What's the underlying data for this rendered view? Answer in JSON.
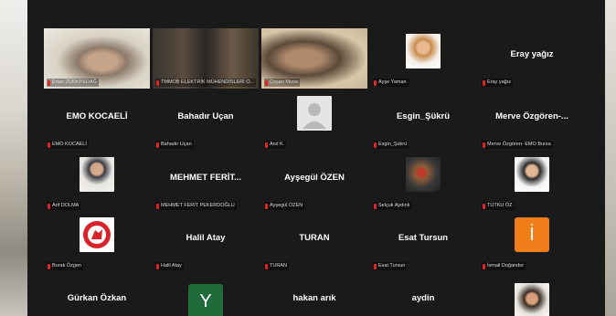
{
  "participants": [
    {
      "id": "p1",
      "display": "",
      "label": "Ertan ZÜRKPEDAĞ",
      "kind": "video"
    },
    {
      "id": "p2",
      "display": "",
      "label": "TMMOB ELEKTRİK MÜHENDİSLERİ O...",
      "kind": "video"
    },
    {
      "id": "p3",
      "display": "",
      "label": "Coşan Musa",
      "kind": "video"
    },
    {
      "id": "p4",
      "display": "",
      "label": "Ayşe Yaman",
      "kind": "avatar",
      "icon": "profile-photo-icon"
    },
    {
      "id": "p5",
      "display": "Eray yağız",
      "label": "Eray yağız",
      "kind": "name"
    },
    {
      "id": "p6",
      "display": "EMO KOCAELİ",
      "label": "EMO KOCAELİ",
      "kind": "name"
    },
    {
      "id": "p7",
      "display": "Bahadır Uçan",
      "label": "Bahadır Uçan",
      "kind": "name"
    },
    {
      "id": "p8",
      "display": "",
      "label": "Anıl K.",
      "kind": "avatar",
      "icon": "default-avatar-icon"
    },
    {
      "id": "p9",
      "display": "Esgin_Şükrü",
      "label": "Esgin_Şükrü",
      "kind": "name"
    },
    {
      "id": "p10",
      "display": "Merve  Özgören-...",
      "label": "Merve Özgören- EMO Bursa",
      "kind": "name"
    },
    {
      "id": "p11",
      "display": "",
      "label": "Arif DOLMA",
      "kind": "avatar",
      "icon": "profile-photo-icon"
    },
    {
      "id": "p12",
      "display": "MEHMET  FERİT...",
      "label": "MEHMET FERİT PEKERDOĞLU",
      "kind": "name"
    },
    {
      "id": "p13",
      "display": "Ayşegül ÖZEN",
      "label": "Ayşegül ÖZEN",
      "kind": "name"
    },
    {
      "id": "p14",
      "display": "",
      "label": "Selçuk Aydınlı",
      "kind": "avatar",
      "icon": "profile-photo-icon"
    },
    {
      "id": "p15",
      "display": "",
      "label": "TUTKU ÖZ",
      "kind": "avatar",
      "icon": "profile-photo-icon"
    },
    {
      "id": "p16",
      "display": "",
      "label": "Burak Özgen",
      "kind": "avatar",
      "icon": "club-logo-icon"
    },
    {
      "id": "p17",
      "display": "Halil Atay",
      "label": "Halil Atay",
      "kind": "name"
    },
    {
      "id": "p18",
      "display": "TURAN",
      "label": "TURAN",
      "kind": "name"
    },
    {
      "id": "p19",
      "display": "Esat Tursun",
      "label": "Esat Tursun",
      "kind": "name"
    },
    {
      "id": "p20",
      "display": "",
      "label": "İsmail Doğandor",
      "kind": "initial",
      "initial": "İ"
    },
    {
      "id": "p21",
      "display": "Gürkan Özkan",
      "label": "",
      "kind": "name"
    },
    {
      "id": "p22",
      "display": "",
      "label": "",
      "kind": "initial",
      "initial": "Y"
    },
    {
      "id": "p23",
      "display": "hakan arık",
      "label": "",
      "kind": "name"
    },
    {
      "id": "p24",
      "display": "aydin",
      "label": "",
      "kind": "name"
    },
    {
      "id": "p25",
      "display": "",
      "label": "",
      "kind": "avatar",
      "icon": "profile-photo-icon"
    }
  ],
  "colors": {
    "active_speaker": "#22c55e",
    "muted_mic": "#e02424",
    "initial_orange": "#ef7d1a",
    "initial_green": "#1f6b3a"
  }
}
